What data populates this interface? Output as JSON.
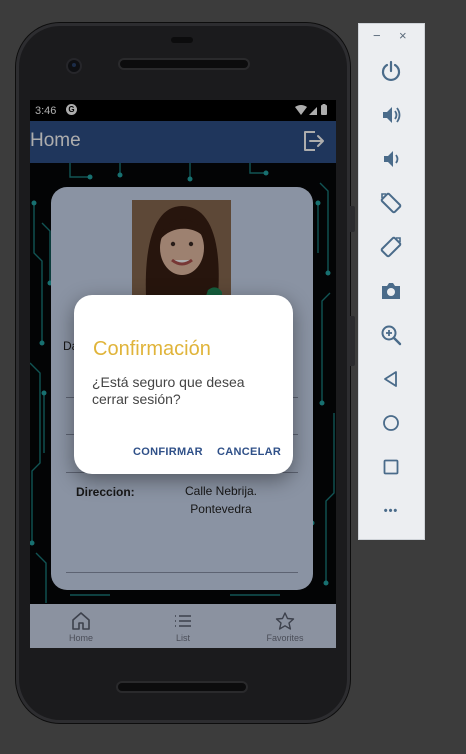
{
  "status_bar": {
    "time": "3:46",
    "g_icon": "G"
  },
  "app_bar": {
    "title": "Home",
    "logout_icon": "logout-icon"
  },
  "profile": {
    "label_partial": "Da",
    "address_label": "Direccion:",
    "address_line1": "Calle Nebrija.",
    "address_line2": "Pontevedra"
  },
  "dialog": {
    "title": "Confirmación",
    "message": "¿Está seguro que desea cerrar sesión?",
    "confirm_label": "CONFIRMAR",
    "cancel_label": "CANCELAR"
  },
  "bottom_nav": [
    {
      "label": "Home",
      "icon": "home-icon"
    },
    {
      "label": "List",
      "icon": "list-icon"
    },
    {
      "label": "Favorites",
      "icon": "star-icon"
    }
  ],
  "emulator_toolbar": {
    "minimize": "−",
    "close": "×",
    "more": "•••"
  },
  "colors": {
    "app_bar": "#2f5088",
    "dialog_title": "#e0b43a",
    "dialog_button": "#2f5088",
    "card": "#ccd9f1"
  }
}
